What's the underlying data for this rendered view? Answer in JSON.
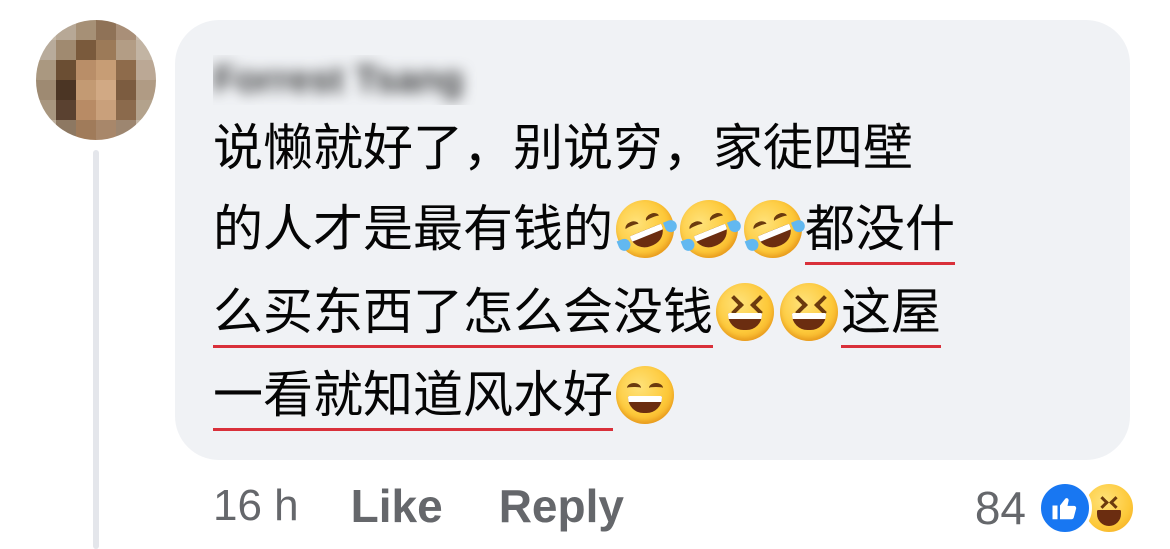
{
  "comment": {
    "author": "Forrest Tsang",
    "lines": [
      [
        "说懒就好了，别说穷，家徒四壁"
      ],
      [
        "的人才是最有钱的",
        "都没什"
      ],
      [
        "么买东西了怎么会没钱",
        "这屋"
      ],
      [
        "一看就知道风水好"
      ]
    ],
    "emoji": {
      "rofl": "rolling-on-floor-laughing",
      "xd": "grinning-squinting-face",
      "grin": "beaming-face-with-smiling-eyes"
    },
    "accent_underline_color": "#d9303a",
    "bubble_color": "#f0f2f5"
  },
  "meta": {
    "time": "16 h",
    "like_label": "Like",
    "reply_label": "Reply"
  },
  "reactions": {
    "count": "84",
    "icons": [
      "like-icon",
      "haha-icon"
    ],
    "like_color": "#1877f2"
  }
}
